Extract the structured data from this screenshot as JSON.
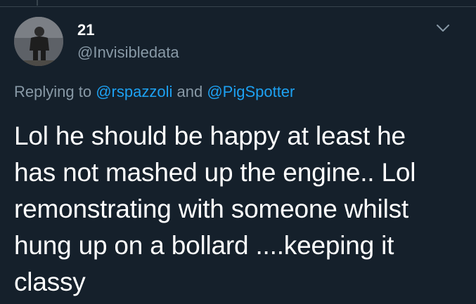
{
  "tweet": {
    "display_name": "21",
    "handle": "@Invisibledata",
    "reply_prefix": "Replying to",
    "reply_to_1": "@rspazzoli",
    "reply_and": "and",
    "reply_to_2": "@PigSpotter",
    "text_lines": [
      "Lol he should be happy at least he",
      "has not mashed up the engine.. Lol",
      "remonstrating with someone whilst",
      "hung up on a bollard ....keeping it",
      "classy"
    ],
    "more_icon": "chevron-down-icon"
  },
  "colors": {
    "background": "#15202b",
    "primary_text": "#ffffff",
    "secondary_text": "#8899a6",
    "link": "#1da1f2",
    "divider": "#38444d"
  }
}
